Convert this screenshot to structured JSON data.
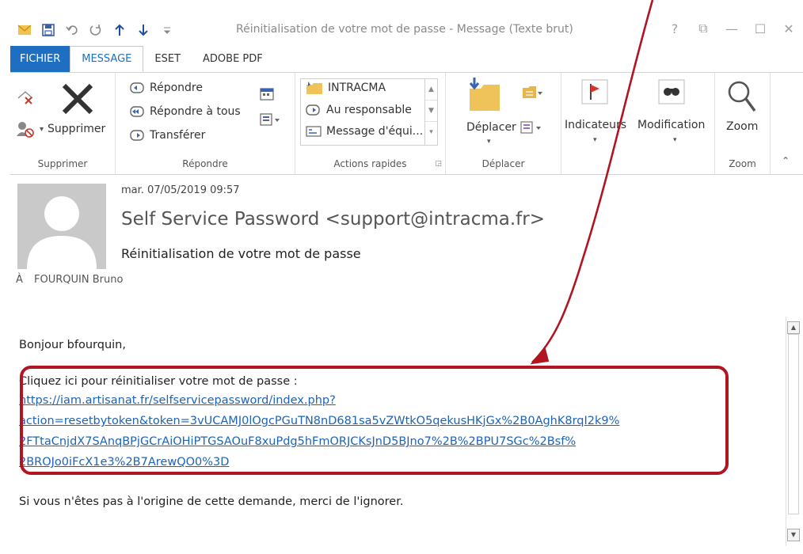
{
  "window": {
    "title": "Réinitialisation de votre mot de passe - Message (Texte brut)",
    "controls": [
      "?",
      "⧉",
      "—",
      "☐",
      "✕"
    ]
  },
  "tabs": [
    {
      "label": "FICHIER"
    },
    {
      "label": "MESSAGE"
    },
    {
      "label": "ESET"
    },
    {
      "label": "ADOBE PDF"
    }
  ],
  "ribbon": {
    "delete_group": {
      "delete_label": "Supprimer",
      "group_label": "Supprimer"
    },
    "respond_group": {
      "reply": "Répondre",
      "reply_all": "Répondre à tous",
      "forward": "Transférer",
      "group_label": "Répondre"
    },
    "quick_steps": {
      "items": [
        "INTRACMA",
        "Au responsable",
        "Message d'équi..."
      ],
      "group_label": "Actions rapides"
    },
    "move_group": {
      "move_label": "Déplacer",
      "group_label": "Déplacer"
    },
    "tags": {
      "flags_label": "Indicateurs"
    },
    "editing": {
      "edit_label": "Modification"
    },
    "zoom_group": {
      "zoom_label": "Zoom",
      "group_label": "Zoom"
    }
  },
  "message": {
    "date": "mar. 07/05/2019 09:57",
    "sender": "Self Service Password <support@intracma.fr>",
    "subject": "Réinitialisation de votre mot de passe",
    "to_label": "À",
    "to_value": "FOURQUIN Bruno",
    "greeting": "Bonjour bfourquin,",
    "click_here": "Cliquez ici pour réinitialiser votre mot de passe :",
    "link_lines": [
      "https://iam.artisanat.fr/selfservicepassword/index.php?",
      "action=resetbytoken&token=3vUCAMJ0lOgcPGuTN8nD681sa5vZWtkO5qekusHKjGx%2B0AghK8rqI2k9%",
      "2FTtaCnjdX7SAnqBPjGCrAiOHiPTGSAOuF8xuPdg5hFmORJCKsJnD5BJno7%2B%2BPU7SGc%2Bsf%",
      "2BROJo0iFcX1e3%2B7ArewQO0%3D"
    ],
    "footer": "Si vous n'êtes pas à l'origine de cette demande, merci de l'ignorer."
  },
  "colors": {
    "file_tab": "#1e6fc1",
    "link": "#1e63b6",
    "highlight": "#b01521"
  }
}
